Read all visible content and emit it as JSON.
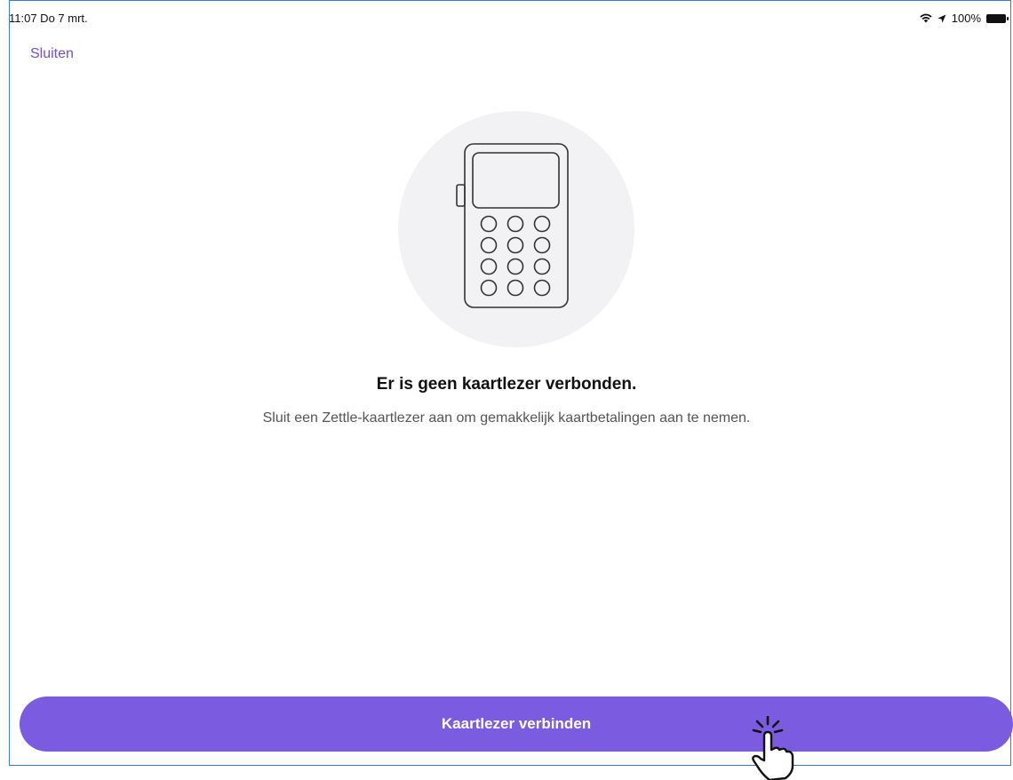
{
  "status_bar": {
    "time": "11:07  Do 7 mrt.",
    "battery": "100%"
  },
  "nav": {
    "close_label": "Sluiten"
  },
  "empty_state": {
    "title": "Er is geen kaartlezer verbonden.",
    "subtitle": "Sluit een Zettle-kaartlezer aan om gemakkelijk kaartbetalingen aan te nemen.",
    "illustration_icon": "card-reader-icon"
  },
  "actions": {
    "connect_label": "Kaartlezer verbinden"
  },
  "colors": {
    "accent": "#7b5ce0",
    "link": "#6e4fd6",
    "frame": "#3a78d8"
  }
}
